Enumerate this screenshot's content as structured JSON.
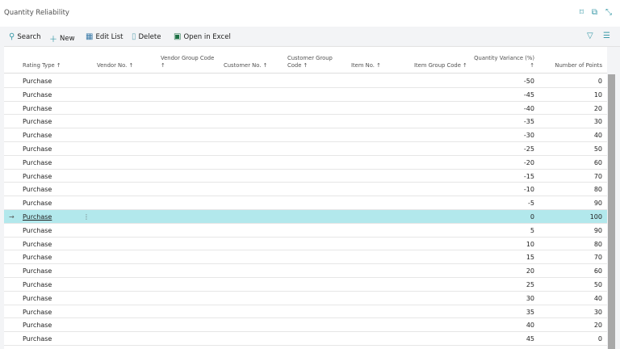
{
  "title": "Quantity Reliability",
  "toolbar": {
    "search": "Search",
    "new": "New",
    "edit_list": "Edit List",
    "delete": "Delete",
    "open_excel": "Open in Excel"
  },
  "columns": [
    "Rating Type ↑",
    "Vendor No. ↑",
    "Vendor Group Code ↑",
    "Customer No. ↑",
    "Customer Group Code ↑",
    "Item No. ↑",
    "Item Group Code ↑",
    "Quantity Variance (%) ↑",
    "Number of Points"
  ],
  "col_lines": {
    "vgc1": "Vendor Group Code",
    "vgc2": "↑",
    "cgc1": "Customer Group",
    "cgc2": "Code ↑",
    "qv1": "Quantity Variance (%)",
    "qv2": "↑"
  },
  "selected_index": 10,
  "rows": [
    {
      "type": "Purchase",
      "qv": "-50",
      "pts": "0"
    },
    {
      "type": "Purchase",
      "qv": "-45",
      "pts": "10"
    },
    {
      "type": "Purchase",
      "qv": "-40",
      "pts": "20"
    },
    {
      "type": "Purchase",
      "qv": "-35",
      "pts": "30"
    },
    {
      "type": "Purchase",
      "qv": "-30",
      "pts": "40"
    },
    {
      "type": "Purchase",
      "qv": "-25",
      "pts": "50"
    },
    {
      "type": "Purchase",
      "qv": "-20",
      "pts": "60"
    },
    {
      "type": "Purchase",
      "qv": "-15",
      "pts": "70"
    },
    {
      "type": "Purchase",
      "qv": "-10",
      "pts": "80"
    },
    {
      "type": "Purchase",
      "qv": "-5",
      "pts": "90"
    },
    {
      "type": "Purchase",
      "qv": "0",
      "pts": "100"
    },
    {
      "type": "Purchase",
      "qv": "5",
      "pts": "90"
    },
    {
      "type": "Purchase",
      "qv": "10",
      "pts": "80"
    },
    {
      "type": "Purchase",
      "qv": "15",
      "pts": "70"
    },
    {
      "type": "Purchase",
      "qv": "20",
      "pts": "60"
    },
    {
      "type": "Purchase",
      "qv": "25",
      "pts": "50"
    },
    {
      "type": "Purchase",
      "qv": "30",
      "pts": "40"
    },
    {
      "type": "Purchase",
      "qv": "35",
      "pts": "30"
    },
    {
      "type": "Purchase",
      "qv": "40",
      "pts": "20"
    },
    {
      "type": "Purchase",
      "qv": "45",
      "pts": "0"
    }
  ]
}
